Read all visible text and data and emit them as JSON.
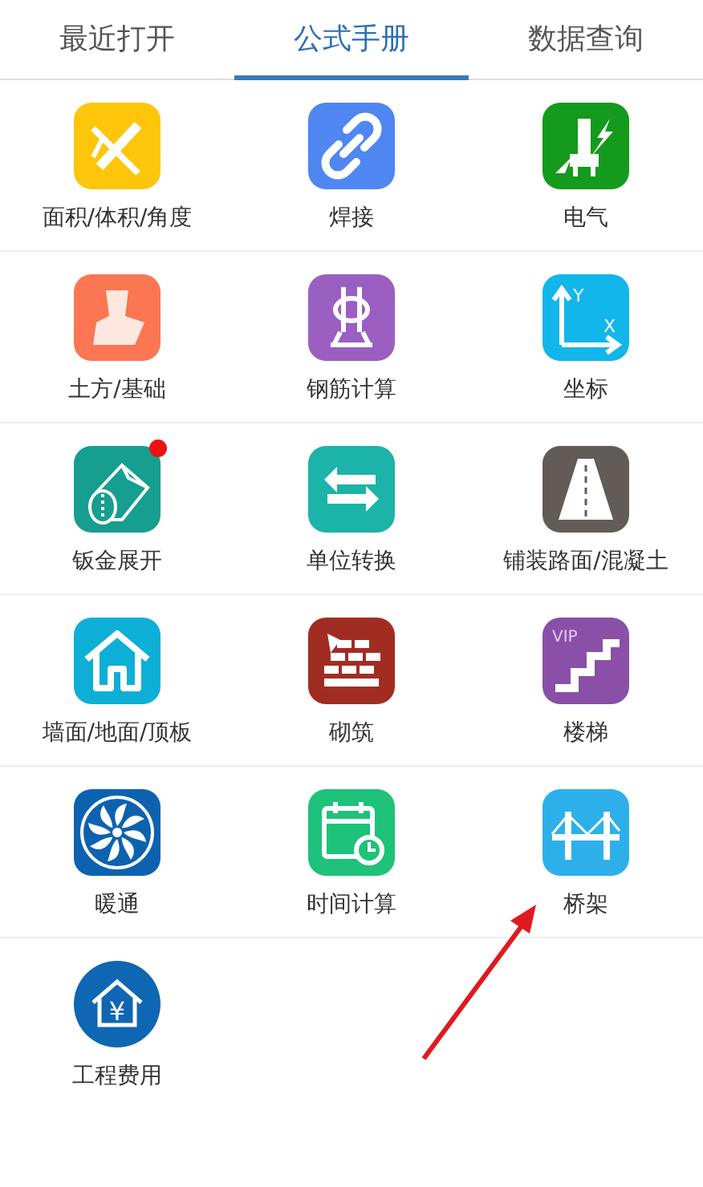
{
  "tabs": [
    {
      "label": "最近打开",
      "selected": false
    },
    {
      "label": "公式手册",
      "selected": true
    },
    {
      "label": "数据查询",
      "selected": false
    }
  ],
  "items": [
    {
      "label": "面积/体积/角度",
      "kind": "drafting",
      "color": "#fdc60a"
    },
    {
      "label": "焊接",
      "kind": "link",
      "color": "#4f86f2"
    },
    {
      "label": "电气",
      "kind": "electric",
      "color": "#149a1c"
    },
    {
      "label": "土方/基础",
      "kind": "earthwork",
      "color": "#fb7652"
    },
    {
      "label": "钢筋计算",
      "kind": "rebar",
      "color": "#9a5fc0"
    },
    {
      "label": "坐标",
      "kind": "axes",
      "color": "#12b6ea",
      "icon_labels": [
        "Y",
        "X"
      ]
    },
    {
      "label": "钣金展开",
      "kind": "sheetmetal",
      "color": "#169e90",
      "badge": true
    },
    {
      "label": "单位转换",
      "kind": "swap",
      "color": "#1cb3a8"
    },
    {
      "label": "铺装路面/混凝土",
      "kind": "road",
      "color": "#635b57"
    },
    {
      "label": "墙面/地面/顶板",
      "kind": "house",
      "color": "#0eafd6"
    },
    {
      "label": "砌筑",
      "kind": "bricks",
      "color": "#a12d22"
    },
    {
      "label": "楼梯",
      "kind": "stairs",
      "color": "#8a4fa7",
      "icon_labels": [
        "VIP"
      ]
    },
    {
      "label": "暖通",
      "kind": "fan",
      "color": "#0d62b0"
    },
    {
      "label": "时间计算",
      "kind": "calendar",
      "color": "#1ec27a"
    },
    {
      "label": "桥架",
      "kind": "bridge",
      "color": "#2db0ea"
    },
    {
      "label": "工程费用",
      "kind": "money",
      "color": "#0f66b3",
      "icon_labels": [
        "¥"
      ]
    }
  ]
}
